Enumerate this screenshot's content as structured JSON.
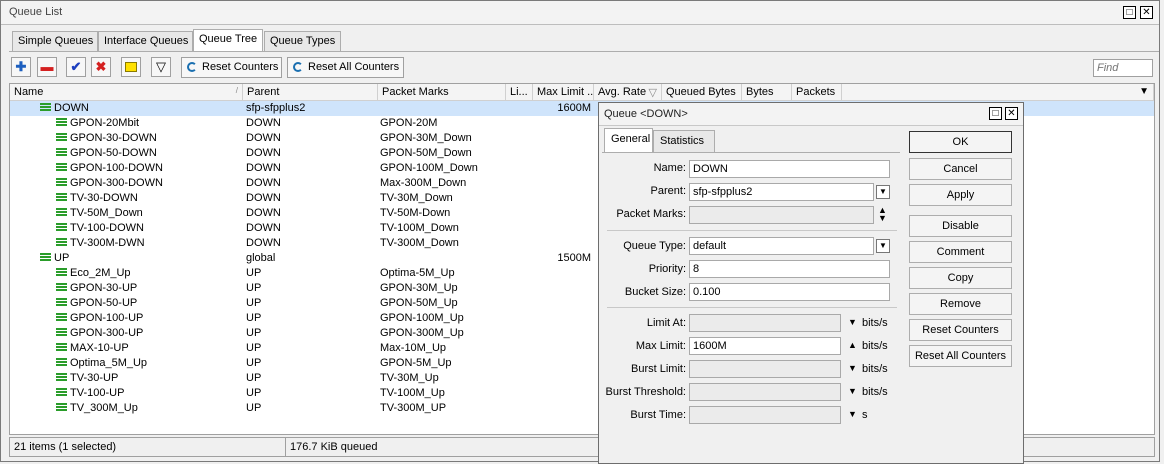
{
  "window": {
    "title": "Queue List"
  },
  "tabs": [
    "Simple Queues",
    "Interface Queues",
    "Queue Tree",
    "Queue Types"
  ],
  "toolbar": {
    "reset_counters": "Reset Counters",
    "reset_all_counters": "Reset All Counters",
    "find_placeholder": "Find"
  },
  "columns": [
    "Name",
    "Parent",
    "Packet Marks",
    "Li...",
    "Max Limit ...",
    "Avg. Rate",
    "Queued Bytes",
    "Bytes",
    "Packets"
  ],
  "rows": [
    {
      "name": "DOWN",
      "parent": "sfp-sfpplus2",
      "marks": "",
      "max": "1600M",
      "level": 0,
      "selected": true
    },
    {
      "name": "GPON-20Mbit",
      "parent": "DOWN",
      "marks": "GPON-20M",
      "max": "",
      "level": 1
    },
    {
      "name": "GPON-30-DOWN",
      "parent": "DOWN",
      "marks": "GPON-30M_Down",
      "max": "",
      "level": 1
    },
    {
      "name": "GPON-50-DOWN",
      "parent": "DOWN",
      "marks": "GPON-50M_Down",
      "max": "",
      "level": 1
    },
    {
      "name": "GPON-100-DOWN",
      "parent": "DOWN",
      "marks": "GPON-100M_Down",
      "max": "",
      "level": 1
    },
    {
      "name": "GPON-300-DOWN",
      "parent": "DOWN",
      "marks": "Max-300M_Down",
      "max": "",
      "level": 1
    },
    {
      "name": "TV-30-DOWN",
      "parent": "DOWN",
      "marks": "TV-30M_Down",
      "max": "",
      "level": 1
    },
    {
      "name": "TV-50M_Down",
      "parent": "DOWN",
      "marks": "TV-50M-Down",
      "max": "",
      "level": 1
    },
    {
      "name": "TV-100-DOWN",
      "parent": "DOWN",
      "marks": "TV-100M_Down",
      "max": "",
      "level": 1
    },
    {
      "name": "TV-300M-DWN",
      "parent": "DOWN",
      "marks": "TV-300M_Down",
      "max": "",
      "level": 1
    },
    {
      "name": "UP",
      "parent": "global",
      "marks": "",
      "max": "1500M",
      "level": 0
    },
    {
      "name": "Eco_2M_Up",
      "parent": "UP",
      "marks": "Optima-5M_Up",
      "max": "",
      "level": 1
    },
    {
      "name": "GPON-30-UP",
      "parent": "UP",
      "marks": "GPON-30M_Up",
      "max": "",
      "level": 1
    },
    {
      "name": "GPON-50-UP",
      "parent": "UP",
      "marks": "GPON-50M_Up",
      "max": "",
      "level": 1
    },
    {
      "name": "GPON-100-UP",
      "parent": "UP",
      "marks": "GPON-100M_Up",
      "max": "",
      "level": 1
    },
    {
      "name": "GPON-300-UP",
      "parent": "UP",
      "marks": "GPON-300M_Up",
      "max": "",
      "level": 1
    },
    {
      "name": "MAX-10-UP",
      "parent": "UP",
      "marks": "Max-10M_Up",
      "max": "",
      "level": 1
    },
    {
      "name": "Optima_5M_Up",
      "parent": "UP",
      "marks": "GPON-5M_Up",
      "max": "",
      "level": 1
    },
    {
      "name": "TV-30-UP",
      "parent": "UP",
      "marks": "TV-30M_Up",
      "max": "",
      "level": 1
    },
    {
      "name": "TV-100-UP",
      "parent": "UP",
      "marks": "TV-100M_Up",
      "max": "",
      "level": 1
    },
    {
      "name": "TV_300M_Up",
      "parent": "UP",
      "marks": "TV-300M_UP",
      "max": "",
      "level": 1
    }
  ],
  "status": {
    "items": "21 items (1 selected)",
    "queued": "176.7 KiB queued"
  },
  "dialog": {
    "title": "Queue <DOWN>",
    "tabs": [
      "General",
      "Statistics"
    ],
    "labels": {
      "name": "Name:",
      "parent": "Parent:",
      "packet_marks": "Packet Marks:",
      "queue_type": "Queue Type:",
      "priority": "Priority:",
      "bucket_size": "Bucket Size:",
      "limit_at": "Limit At:",
      "max_limit": "Max Limit:",
      "burst_limit": "Burst Limit:",
      "burst_threshold": "Burst Threshold:",
      "burst_time": "Burst Time:"
    },
    "values": {
      "name": "DOWN",
      "parent": "sfp-sfpplus2",
      "packet_marks": "",
      "queue_type": "default",
      "priority": "8",
      "bucket_size": "0.100",
      "limit_at": "",
      "max_limit": "1600M",
      "burst_limit": "",
      "burst_threshold": "",
      "burst_time": ""
    },
    "units": {
      "bits": "bits/s",
      "s": "s"
    },
    "buttons": [
      "OK",
      "Cancel",
      "Apply",
      "Disable",
      "Comment",
      "Copy",
      "Remove",
      "Reset Counters",
      "Reset All Counters"
    ]
  },
  "colors": {
    "selection": "#cfe4fb",
    "queue_icon": "#2a9d2a",
    "add_icon": "#1d5fbf",
    "remove_icon": "#d42020"
  }
}
